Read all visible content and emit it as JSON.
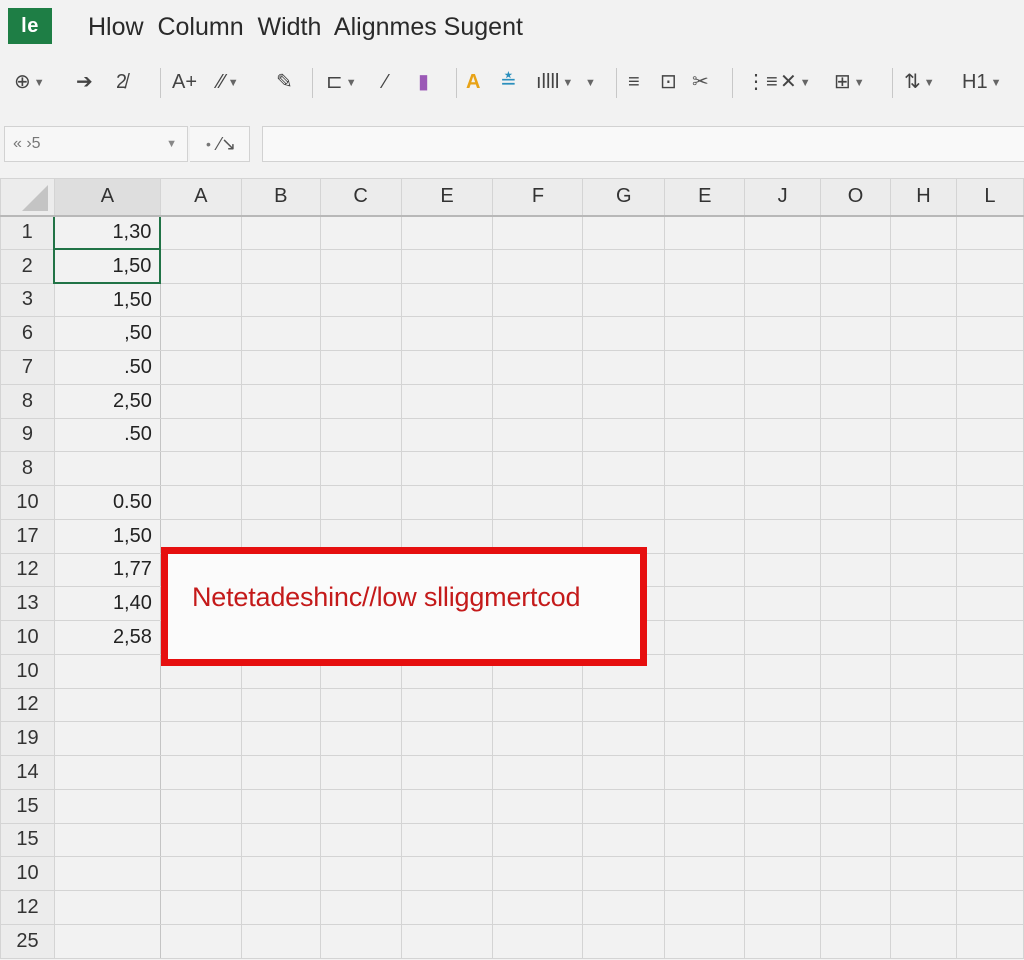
{
  "app": {
    "logo": "le",
    "title": "Hlow  Column  Width  Alignmes Sugent"
  },
  "toolbar": {
    "tools": [
      {
        "name": "format-tool-icon",
        "glyph": "⊕",
        "caret": true
      },
      {
        "name": "cut-tool-icon",
        "glyph": "➔",
        "caret": false
      },
      {
        "name": "symbols-tool-icon",
        "glyph": "2̸",
        "caret": false
      },
      {
        "name": "font-size-increase-icon",
        "glyph": "A+",
        "caret": false
      },
      {
        "name": "brush-tool-icon",
        "glyph": "⁄⁄",
        "caret": true
      },
      {
        "name": "pen-tool-icon",
        "glyph": "✎",
        "caret": false
      },
      {
        "name": "align-tool-icon",
        "glyph": "⊏",
        "caret": true
      },
      {
        "name": "line-tool-icon",
        "glyph": "⁄",
        "caret": false
      },
      {
        "name": "color-bar-icon",
        "glyph": "▮",
        "caret": false
      },
      {
        "name": "font-color-icon",
        "glyph": "A",
        "caret": false
      },
      {
        "name": "highlight-icon",
        "glyph": "≛",
        "caret": false
      },
      {
        "name": "column-chart-icon",
        "glyph": "ıllll",
        "caret": true
      },
      {
        "name": "extra-dropdown-icon",
        "glyph": "",
        "caret": true
      },
      {
        "name": "lines-icon",
        "glyph": "≡",
        "caret": false
      },
      {
        "name": "wrap-icon",
        "glyph": "⊡",
        "caret": false
      },
      {
        "name": "scissors-icon",
        "glyph": "✂",
        "caret": false
      },
      {
        "name": "list-icon",
        "glyph": "⋮≡",
        "caret": false
      },
      {
        "name": "cross-tool-icon",
        "glyph": "✕",
        "caret": true
      },
      {
        "name": "merge-tool-icon",
        "glyph": "⊞",
        "caret": true
      },
      {
        "name": "sort-tool-icon",
        "glyph": "⇅",
        "caret": true
      },
      {
        "name": "heading-tool-icon",
        "glyph": "H1",
        "caret": true
      }
    ]
  },
  "formula_bar": {
    "name_box": "«  ›5",
    "fx_dot": "•",
    "fx_symbol": "⁄↘",
    "formula_value": ""
  },
  "grid": {
    "column_headers": [
      "A",
      "A",
      "B",
      "C",
      "E",
      "F",
      "G",
      "E",
      "J",
      "O",
      "H",
      "L"
    ],
    "rows": [
      {
        "label": "1",
        "value": "1,30",
        "selected": true
      },
      {
        "label": "2",
        "value": "1,50",
        "selected": true
      },
      {
        "label": "3",
        "value": "1,50",
        "selected": false
      },
      {
        "label": "6",
        "value": ",50",
        "selected": false
      },
      {
        "label": "7",
        "value": ".50",
        "selected": false
      },
      {
        "label": "8",
        "value": "2,50",
        "selected": false
      },
      {
        "label": "9",
        "value": ".50",
        "selected": false
      },
      {
        "label": "8",
        "value": "",
        "selected": false
      },
      {
        "label": "10",
        "value": "0.50",
        "selected": false
      },
      {
        "label": "17",
        "value": "1,50",
        "selected": false
      },
      {
        "label": "12",
        "value": "1,77",
        "selected": false
      },
      {
        "label": "13",
        "value": "1,40",
        "selected": false
      },
      {
        "label": "10",
        "value": "2,58",
        "selected": false
      },
      {
        "label": "10",
        "value": "",
        "selected": false
      },
      {
        "label": "12",
        "value": "",
        "selected": false
      },
      {
        "label": "19",
        "value": "",
        "selected": false
      },
      {
        "label": "14",
        "value": "",
        "selected": false
      },
      {
        "label": "15",
        "value": "",
        "selected": false
      },
      {
        "label": "15",
        "value": "",
        "selected": false
      },
      {
        "label": "10",
        "value": "",
        "selected": false
      },
      {
        "label": "12",
        "value": "",
        "selected": false
      },
      {
        "label": "25",
        "value": "",
        "selected": false
      }
    ]
  },
  "annotation": {
    "text": "Netetadeshinc//low slliggmertcod",
    "border_color": "#e60f0f",
    "text_color": "#c41a1a"
  },
  "colors": {
    "logo_green": "#1e7e45",
    "selection_green": "#217346",
    "font_color_yellow": "#e8a317"
  }
}
